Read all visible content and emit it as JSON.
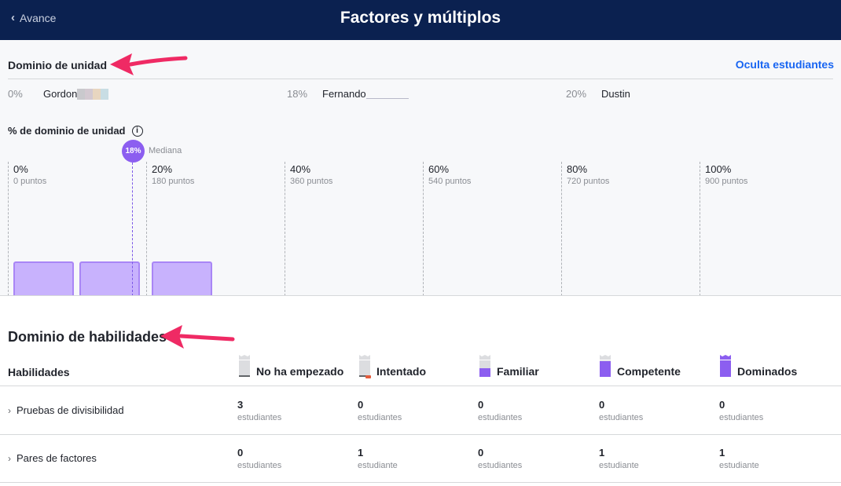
{
  "header": {
    "back_label": "Avance",
    "title": "Factores y múltiplos"
  },
  "unit": {
    "heading": "Dominio de unidad",
    "hide_students": "Oculta estudiantes",
    "students": [
      {
        "pct": "0%",
        "name": "Gordon"
      },
      {
        "pct": "18%",
        "name": "Fernando"
      },
      {
        "pct": "20%",
        "name": "Dustin"
      }
    ],
    "mastery_label": "% de dominio de unidad",
    "median_value": "18%",
    "median_label": "Mediana",
    "ticks": [
      {
        "pct": "0%",
        "points": "0 puntos"
      },
      {
        "pct": "20%",
        "points": "180 puntos"
      },
      {
        "pct": "40%",
        "points": "360 puntos"
      },
      {
        "pct": "60%",
        "points": "540 puntos"
      },
      {
        "pct": "80%",
        "points": "720 puntos"
      },
      {
        "pct": "100%",
        "points": "900 puntos"
      }
    ]
  },
  "chart_data": {
    "type": "bar",
    "x_unit": "% de dominio de unidad",
    "x": [
      0,
      18,
      20
    ],
    "values": [
      1,
      1,
      1
    ],
    "median": 18,
    "xlim": [
      0,
      100
    ]
  },
  "skills": {
    "heading": "Dominio de habilidades",
    "column_label": "Habilidades",
    "levels": [
      {
        "label": "No ha empezado",
        "icon": "level-not-started-icon"
      },
      {
        "label": "Intentado",
        "icon": "level-attempted-icon"
      },
      {
        "label": "Familiar",
        "icon": "level-familiar-icon"
      },
      {
        "label": "Competente",
        "icon": "level-proficient-icon"
      },
      {
        "label": "Dominados",
        "icon": "level-mastered-icon"
      }
    ],
    "rows": [
      {
        "name": "Pruebas de divisibilidad",
        "cells": [
          {
            "count": "3",
            "unit": "estudiantes"
          },
          {
            "count": "0",
            "unit": "estudiantes"
          },
          {
            "count": "0",
            "unit": "estudiantes"
          },
          {
            "count": "0",
            "unit": "estudiantes"
          },
          {
            "count": "0",
            "unit": "estudiantes"
          }
        ]
      },
      {
        "name": "Pares de factores",
        "cells": [
          {
            "count": "0",
            "unit": "estudiantes"
          },
          {
            "count": "1",
            "unit": "estudiante"
          },
          {
            "count": "0",
            "unit": "estudiantes"
          },
          {
            "count": "1",
            "unit": "estudiante"
          },
          {
            "count": "1",
            "unit": "estudiante"
          }
        ]
      }
    ]
  },
  "colors": {
    "header_bg": "#0b2150",
    "link": "#1865f2",
    "accent_purple": "#8c5ef0",
    "bar_fill": "#c8b2fd",
    "arrow": "#ef2a64"
  }
}
